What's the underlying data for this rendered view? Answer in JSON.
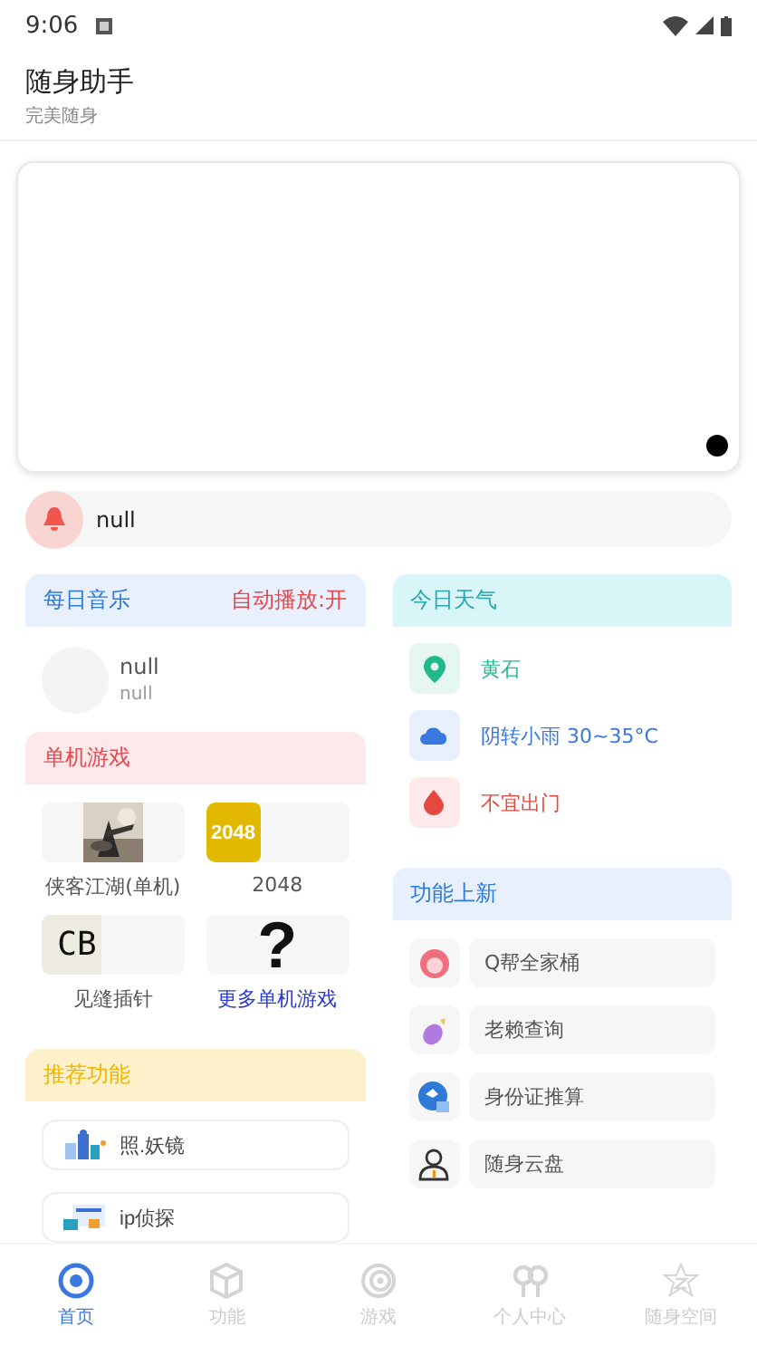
{
  "status_bar": {
    "time": "9:06"
  },
  "header": {
    "title": "随身助手",
    "subtitle": "完美随身"
  },
  "notice": {
    "text": "null"
  },
  "music": {
    "title": "每日音乐",
    "autoplay": "自动播放:开",
    "song": "null",
    "artist": "null"
  },
  "games": {
    "title": "单机游戏",
    "items": [
      {
        "kind": "picture",
        "label": "侠客江湖(单机)"
      },
      {
        "kind": "tile",
        "tile_text": "2048",
        "label": "2048"
      },
      {
        "kind": "letters",
        "tile_text": "CB",
        "label": "见缝插针"
      },
      {
        "kind": "glyph",
        "tile_text": "?",
        "label": "更多单机游戏",
        "link": true
      }
    ]
  },
  "recommended": {
    "title": "推荐功能",
    "items": [
      {
        "label": "照.妖镜"
      },
      {
        "label": "ip侦探"
      }
    ]
  },
  "weather": {
    "title": "今日天气",
    "rows": [
      {
        "kind": "location",
        "text": "黄石",
        "color": "#22b98a"
      },
      {
        "kind": "cloud",
        "text": "阴转小雨 30~35°C",
        "color": "#3a78e0"
      },
      {
        "kind": "drop",
        "text": "不宜出门",
        "color": "#e5483f"
      }
    ]
  },
  "features": {
    "title": "功能上新",
    "items": [
      {
        "kind": "face",
        "label": "Q帮全家桶"
      },
      {
        "kind": "eggplant",
        "label": "老赖查询"
      },
      {
        "kind": "badge",
        "label": "身份证推算"
      },
      {
        "kind": "person",
        "label": "随身云盘"
      }
    ]
  },
  "nav": [
    {
      "kind": "home",
      "label": "首页",
      "selected": true
    },
    {
      "kind": "cube",
      "label": "功能",
      "selected": false
    },
    {
      "kind": "spiral",
      "label": "游戏",
      "selected": false
    },
    {
      "kind": "balloons",
      "label": "个人中心",
      "selected": false
    },
    {
      "kind": "star",
      "label": "随身空间",
      "selected": false
    }
  ]
}
